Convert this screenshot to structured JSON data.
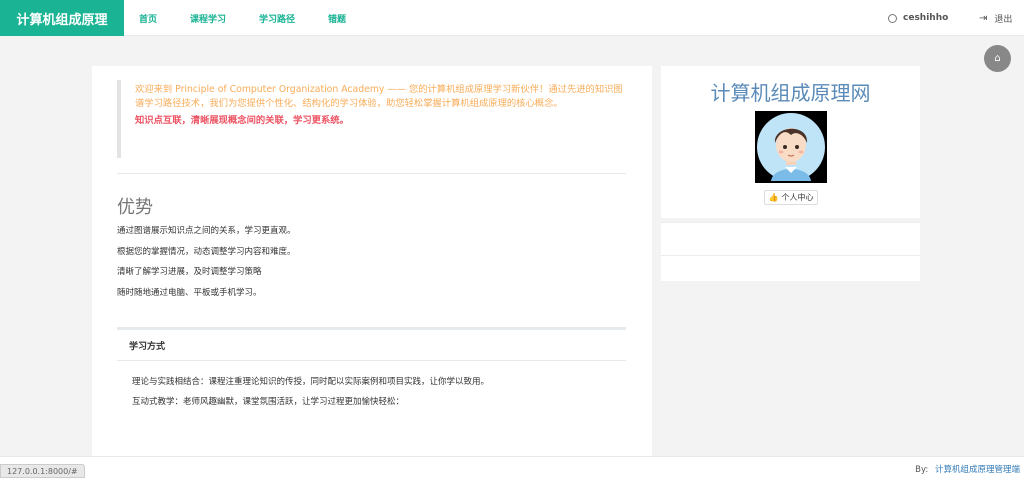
{
  "brand": "计算机组成原理",
  "nav": {
    "items": [
      "首页",
      "课程学习",
      "学习路径",
      "错题"
    ]
  },
  "user": {
    "name": "ceshihho",
    "logout": "退出"
  },
  "welcome": {
    "intro": "欢迎来到 Principle of Computer Organization Academy —— 您的计算机组成原理学习新伙伴！通过先进的知识图谱学习路径技术，我们为您提供个性化、结构化的学习体验，助您轻松掌握计算机组成原理的核心概念。",
    "highlight": "知识点互联，清晰展现概念间的关联，学习更系统。"
  },
  "advantages": {
    "title": "优势",
    "items": [
      "通过图谱展示知识点之间的关系，学习更直观。",
      "根据您的掌握情况，动态调整学习内容和难度。",
      "清晰了解学习进展，及时调整学习策略",
      "随时随地通过电脑、平板或手机学习。"
    ]
  },
  "ways": {
    "title": "学习方式",
    "items": [
      "理论与实践相结合：课程注重理论知识的传授，同时配以实际案例和项目实践，让你学以致用。",
      "互动式教学：老师风趣幽默，课堂氛围活跃，让学习过程更加愉快轻松："
    ]
  },
  "side": {
    "title": "计算机组成原理网",
    "profile_button": "个人中心"
  },
  "footer": {
    "by_label": "By:",
    "by_link": "计算机组成原理管理端"
  },
  "status_url": "127.0.0.1:8000/#",
  "colors": {
    "brand": "#1ab394",
    "warning": "#f8ac59",
    "danger": "#ed5565",
    "link": "#337ab7"
  },
  "icons": {
    "user": "user-circle-icon",
    "logout": "sign-out-icon",
    "home": "home-icon",
    "profile": "thumbs-up-icon"
  }
}
